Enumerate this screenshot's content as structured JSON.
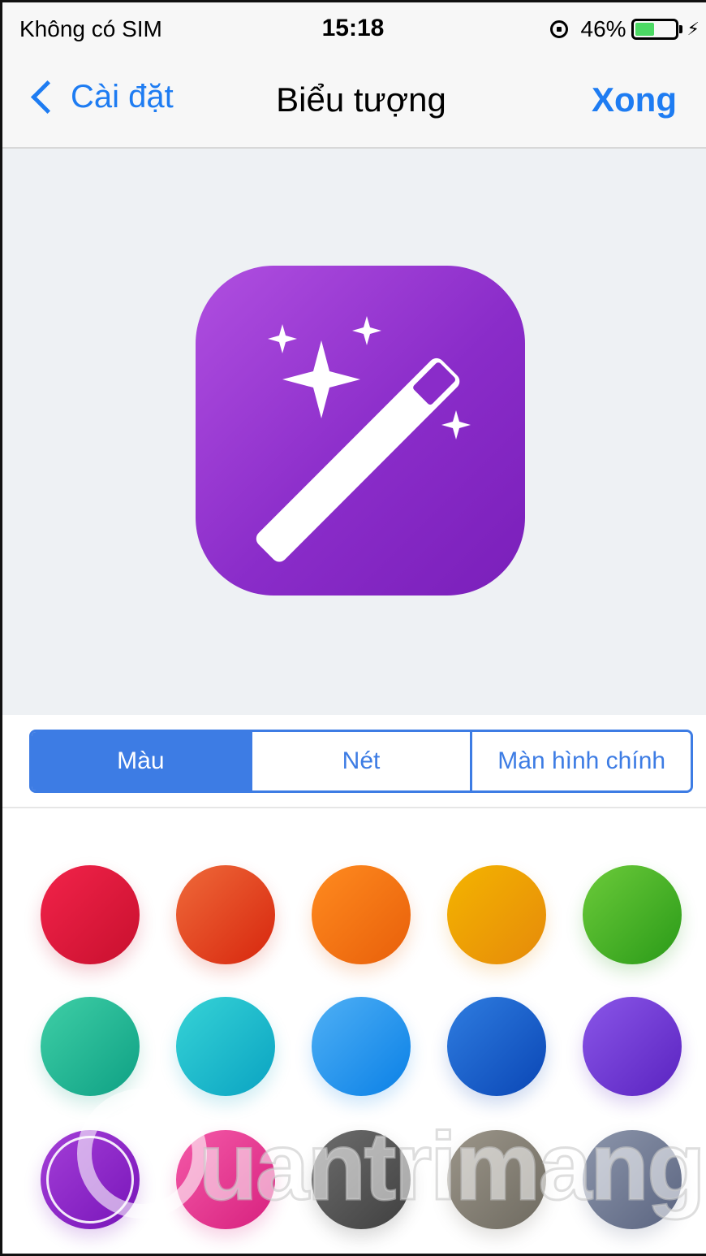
{
  "status_bar": {
    "carrier": "Không có SIM",
    "time": "15:18",
    "battery_percent": "46%",
    "battery_level": 0.46,
    "icons": [
      "orientation-lock-icon",
      "battery-icon",
      "charging-icon"
    ]
  },
  "nav": {
    "back_label": "Cài đặt",
    "title": "Biểu tượng",
    "done_label": "Xong",
    "accent_color": "#1e7cf2"
  },
  "preview": {
    "icon_name": "magic-wand-icon",
    "icon_colors": [
      "#b04fe0",
      "#7a1fba"
    ]
  },
  "segments": [
    {
      "label": "Màu",
      "active": true
    },
    {
      "label": "Nét",
      "active": false
    },
    {
      "label": "Màn hình chính",
      "active": false
    }
  ],
  "colors": [
    {
      "name": "red",
      "from": "#f2234a",
      "to": "#c8102e",
      "selected": false
    },
    {
      "name": "red-orange",
      "from": "#ef6a3a",
      "to": "#d7260d",
      "selected": false
    },
    {
      "name": "orange",
      "from": "#ff8b1f",
      "to": "#e85f0a",
      "selected": false
    },
    {
      "name": "yellow",
      "from": "#f4b400",
      "to": "#e68a0a",
      "selected": false
    },
    {
      "name": "green",
      "from": "#6ccb3a",
      "to": "#2a9a18",
      "selected": false
    },
    {
      "name": "teal",
      "from": "#3fcfa6",
      "to": "#0ea084",
      "selected": false
    },
    {
      "name": "cyan",
      "from": "#36d3d6",
      "to": "#0aa3c2",
      "selected": false
    },
    {
      "name": "light-blue",
      "from": "#4fb0f5",
      "to": "#0a80e6",
      "selected": false
    },
    {
      "name": "blue",
      "from": "#2f7de0",
      "to": "#0a46b5",
      "selected": false
    },
    {
      "name": "indigo",
      "from": "#8a56e8",
      "to": "#5a23c0",
      "selected": false
    },
    {
      "name": "purple",
      "from": "#a43fd8",
      "to": "#7714b8",
      "selected": true
    },
    {
      "name": "pink",
      "from": "#f45aa8",
      "to": "#d7207e",
      "selected": false
    },
    {
      "name": "dark-gray",
      "from": "#6e6e6e",
      "to": "#3f3f3f",
      "selected": false
    },
    {
      "name": "warm-gray",
      "from": "#9c968a",
      "to": "#6e6a60",
      "selected": false
    },
    {
      "name": "slate",
      "from": "#8d96ab",
      "to": "#5a6480",
      "selected": false
    }
  ],
  "watermark": {
    "text": "uantrimang"
  }
}
